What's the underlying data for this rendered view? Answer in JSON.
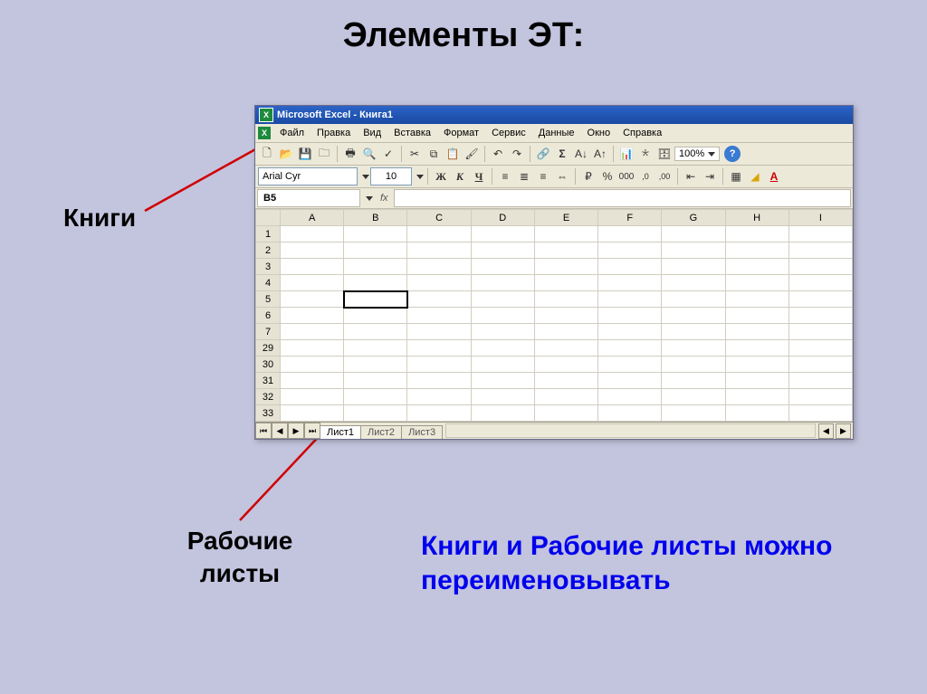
{
  "slide": {
    "title": "Элементы ЭТ:",
    "label_books": "Книги",
    "label_sheets": "Рабочие листы",
    "rename_note": "Книги и Рабочие листы можно переименовывать"
  },
  "excel": {
    "title": "Microsoft Excel - Книга1",
    "font_name": "Arial Cyr",
    "font_size": "10",
    "zoom": "100%",
    "namebox": "B5",
    "fx": "fx",
    "menu": [
      "Файл",
      "Правка",
      "Вид",
      "Вставка",
      "Формат",
      "Сервис",
      "Данные",
      "Окно",
      "Справка"
    ],
    "columns": [
      "A",
      "B",
      "C",
      "D",
      "E",
      "F",
      "G",
      "H",
      "I"
    ],
    "rows": [
      "1",
      "2",
      "3",
      "4",
      "5",
      "6",
      "7",
      "29",
      "30",
      "31",
      "32",
      "33"
    ],
    "selected_row": "5",
    "selected_col": "B",
    "sheets": [
      "Лист1",
      "Лист2",
      "Лист3"
    ],
    "active_sheet": "Лист1",
    "format_labels": {
      "bold": "Ж",
      "italic": "К",
      "underline": "Ч"
    }
  }
}
